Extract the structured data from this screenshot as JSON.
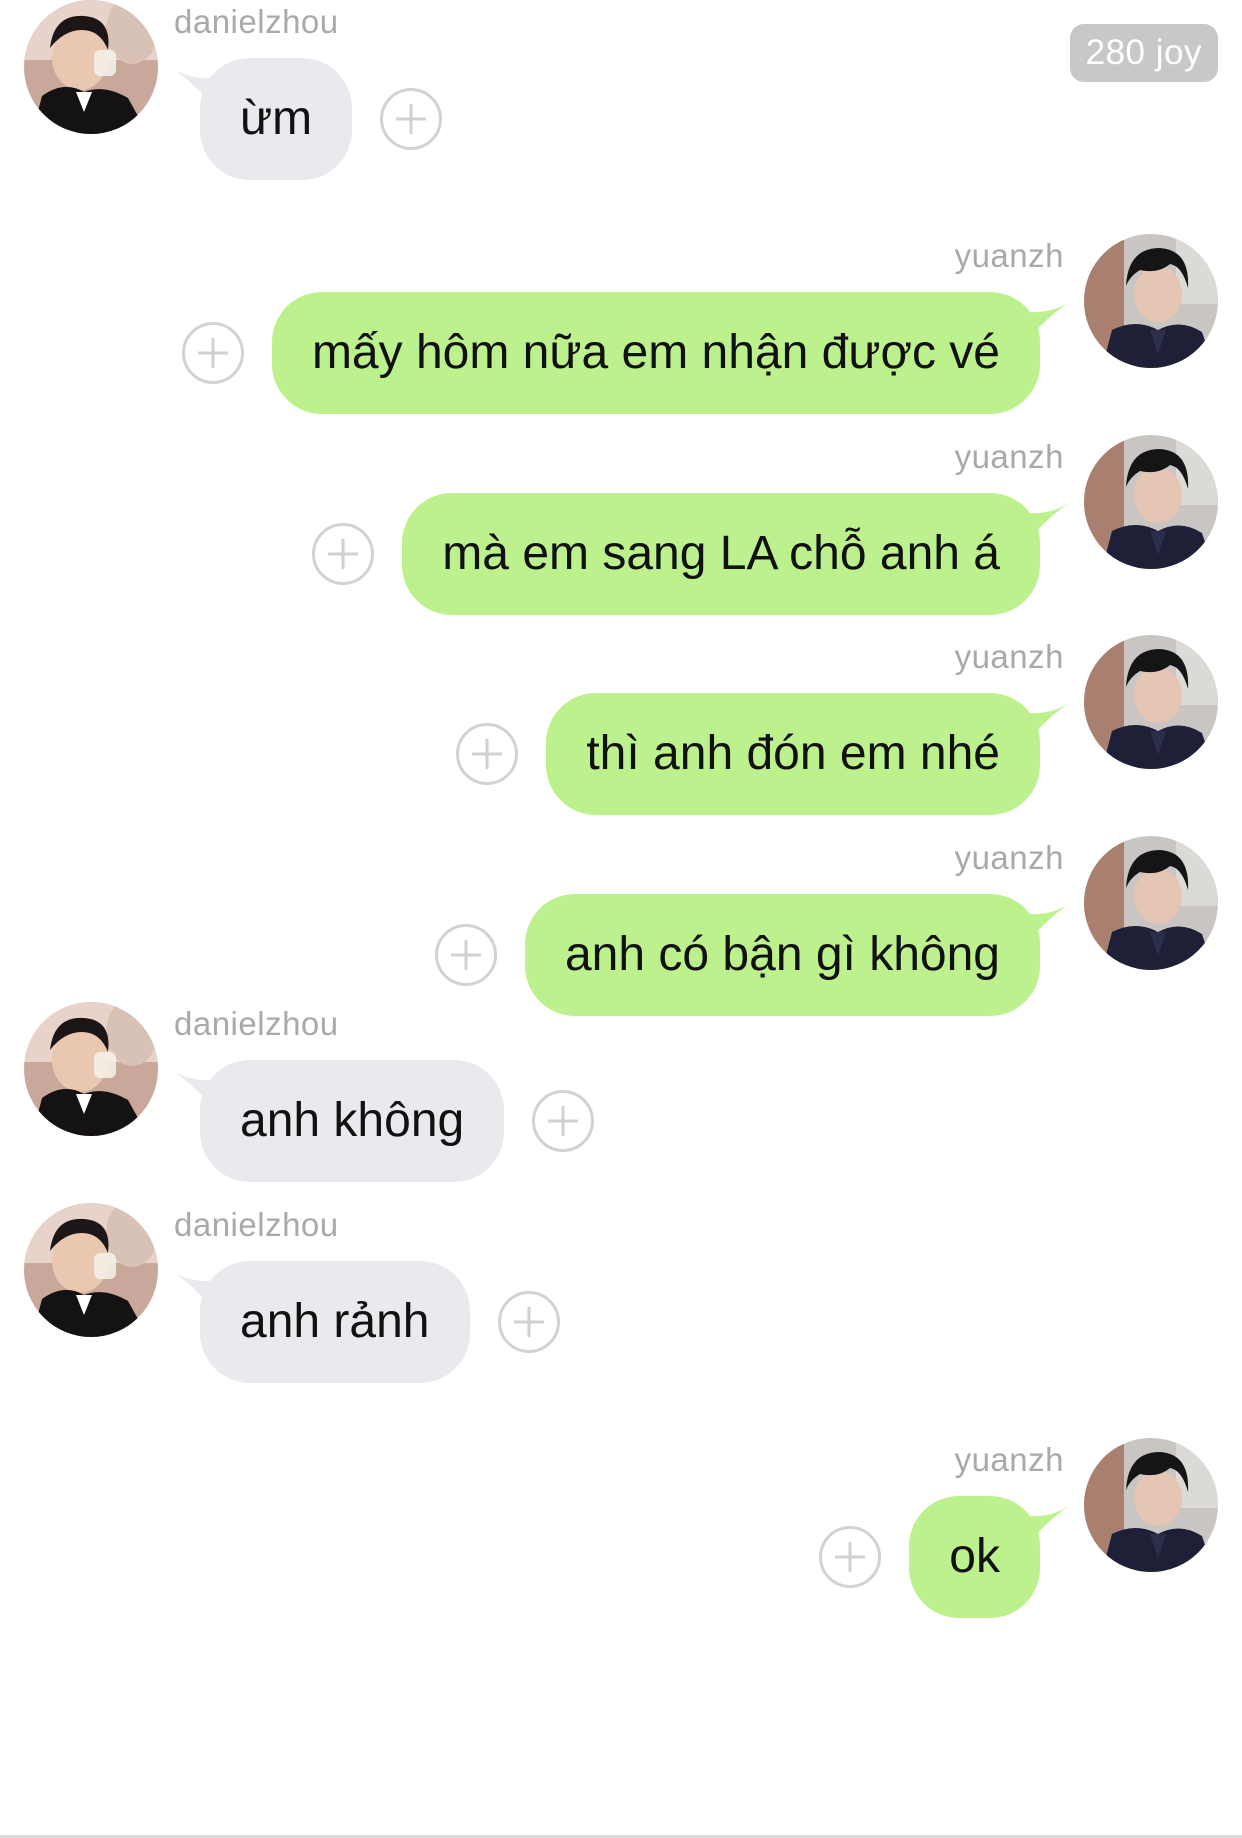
{
  "badge": {
    "text": "280 joy"
  },
  "messages": [
    {
      "side": "left",
      "user": "danielzhou",
      "text": "ừm"
    },
    {
      "side": "right",
      "user": "yuanzh",
      "text": "mấy hôm nữa em nhận được vé"
    },
    {
      "side": "right",
      "user": "yuanzh",
      "text": "mà em sang LA chỗ anh á"
    },
    {
      "side": "right",
      "user": "yuanzh",
      "text": "thì anh đón em nhé"
    },
    {
      "side": "right",
      "user": "yuanzh",
      "text": "anh có bận gì không"
    },
    {
      "side": "left",
      "user": "danielzhou",
      "text": "anh không"
    },
    {
      "side": "left",
      "user": "danielzhou",
      "text": "anh rảnh"
    },
    {
      "side": "right",
      "user": "yuanzh",
      "text": "ok"
    }
  ],
  "colors": {
    "outgoing_bubble": "#bdf18e",
    "incoming_bubble": "#e8eaed",
    "username": "#a9a9a9",
    "badge_bg": "#c8c8c8"
  },
  "icons": {
    "add_reaction": "plus-circle-icon",
    "avatar_left": "danielzhou-avatar",
    "avatar_right": "yuanzh-avatar"
  }
}
